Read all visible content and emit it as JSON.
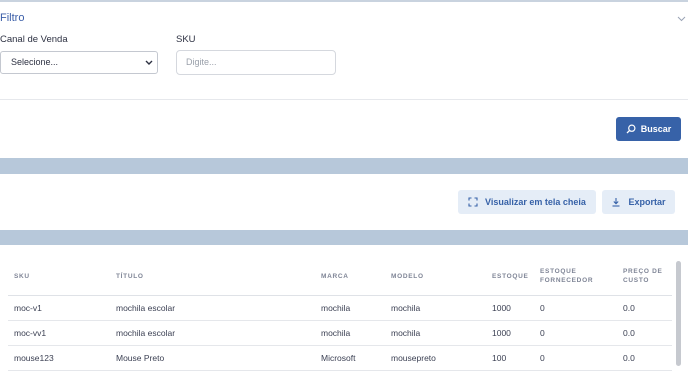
{
  "filter": {
    "title": "Filtro",
    "collapse_icon": "chevron-down-icon",
    "channel_label": "Canal de Venda",
    "channel_value": "Selecione...",
    "sku_label": "SKU",
    "sku_placeholder": "Digite...",
    "search_button": "Buscar",
    "search_icon": "search-icon"
  },
  "toolbar": {
    "fullscreen_button": "Visualizar em tela cheia",
    "fullscreen_icon": "expand-icon",
    "export_button": "Exportar",
    "export_icon": "download-icon"
  },
  "colors": {
    "accent": "#3762a8",
    "band": "#b7c8da",
    "light_button": "#e5edf7"
  },
  "table": {
    "headers": [
      "SKU",
      "TÍTULO",
      "MARCA",
      "MODELO",
      "ESTOQUE",
      "ESTOQUE FORNECEDOR",
      "PREÇO DE CUSTO"
    ],
    "rows": [
      [
        "moc-v1",
        "mochila escolar",
        "mochila",
        "mochila",
        "1000",
        "0",
        "0.0"
      ],
      [
        "moc-vv1",
        "mochila escolar",
        "mochila",
        "mochila",
        "1000",
        "0",
        "0.0"
      ],
      [
        "mouse123",
        "Mouse Preto",
        "Microsoft",
        "mousepreto",
        "100",
        "0",
        "0.0"
      ]
    ]
  }
}
